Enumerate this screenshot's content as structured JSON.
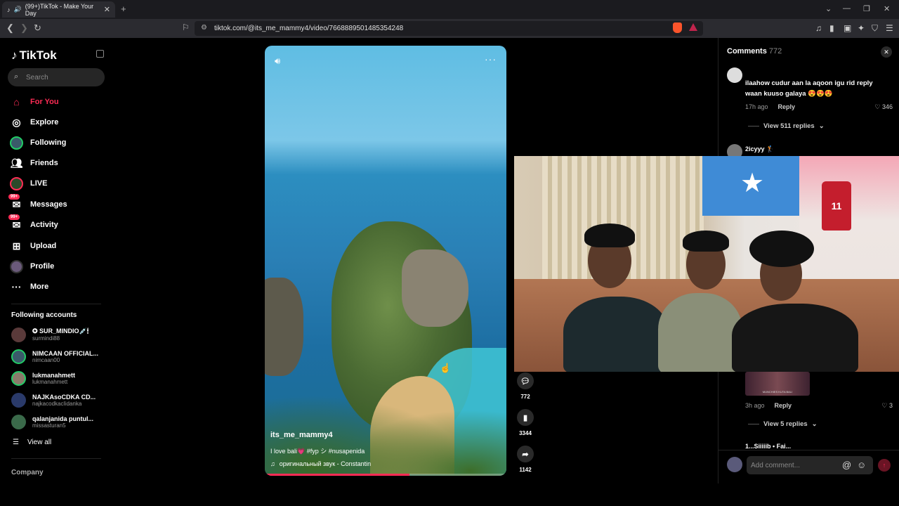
{
  "browser": {
    "tab_title": "(99+)TikTok - Make Your Day",
    "url": "tiktok.com/@its_me_mammy4/video/7668889501485354248"
  },
  "sidebar": {
    "logo": "TikTok",
    "search_placeholder": "Search",
    "nav": [
      {
        "label": "For You",
        "icon": "home-icon"
      },
      {
        "label": "Explore",
        "icon": "compass-icon"
      },
      {
        "label": "Following",
        "icon": "avatar-icon"
      },
      {
        "label": "Friends",
        "icon": "friends-icon"
      },
      {
        "label": "LIVE",
        "icon": "live-icon"
      },
      {
        "label": "Messages",
        "icon": "messages-icon",
        "badge": "99+"
      },
      {
        "label": "Activity",
        "icon": "activity-icon",
        "badge": "99+"
      },
      {
        "label": "Upload",
        "icon": "upload-icon"
      },
      {
        "label": "Profile",
        "icon": "profile-icon"
      },
      {
        "label": "More",
        "icon": "more-icon"
      }
    ],
    "following_title": "Following accounts",
    "accounts": [
      {
        "name": "✪ SUR_MINDIO💉🕯",
        "handle": "surmindi88"
      },
      {
        "name": "NIMCAAN OFFICIAL...",
        "handle": "nimcaan00"
      },
      {
        "name": "lukmanahmett",
        "handle": "lukmanahmett"
      },
      {
        "name": "NAJKAsoCDKA CD...",
        "handle": "najkacodkacIidanka"
      },
      {
        "name": "qalanjanida puntul...",
        "handle": "missasturan5"
      }
    ],
    "view_all": "View all",
    "company": "Company"
  },
  "video": {
    "username": "its_me_mammy4",
    "description": "I love bali💗 #fyp シ #nusapenida",
    "sound": "оригинальный звук - Constantin",
    "progress": 0.6
  },
  "actions": {
    "comments": "772",
    "saves": "3344",
    "shares": "1142"
  },
  "comments": {
    "title": "Comments",
    "count": "772",
    "items": [
      {
        "text": "ilaahow cudur aan la aqoon igu rid reply waan kuuso galaya 😍😍😍",
        "time": "17h ago",
        "reply": "Reply",
        "likes": "346",
        "view_replies": "View 511 replies"
      },
      {
        "name": "2icyyy 🏌"
      },
      {
        "time": "3h ago",
        "reply": "Reply",
        "likes": "3",
        "view_replies": "View 5 replies"
      }
    ],
    "partial_name": "1...Siiiiib • Fai...",
    "input_placeholder": "Add comment..."
  },
  "webcam": {
    "jersey_number": "11"
  }
}
